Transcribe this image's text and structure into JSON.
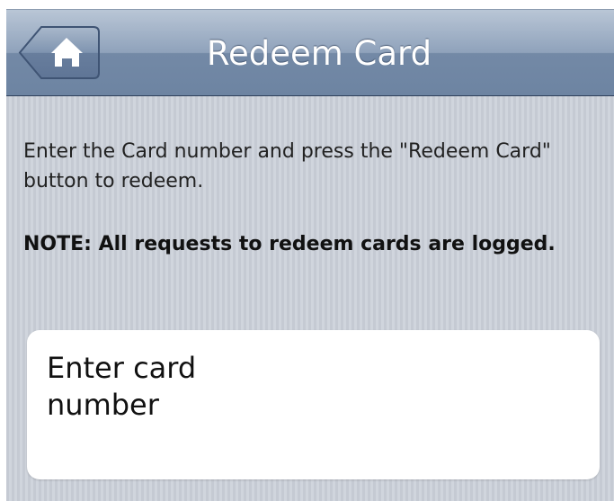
{
  "navbar": {
    "title": "Redeem Card",
    "home_icon": "home-icon"
  },
  "content": {
    "instructions": "Enter the Card number and press the \"Redeem Card\" button to redeem.",
    "note": "NOTE: All requests to redeem cards are logged."
  },
  "card_field": {
    "placeholder": "Enter card number"
  },
  "colors": {
    "navbar_top": "#b9c6d6",
    "navbar_bottom": "#6d84a2",
    "background": "#c9ced6",
    "field_background": "#ffffff"
  }
}
